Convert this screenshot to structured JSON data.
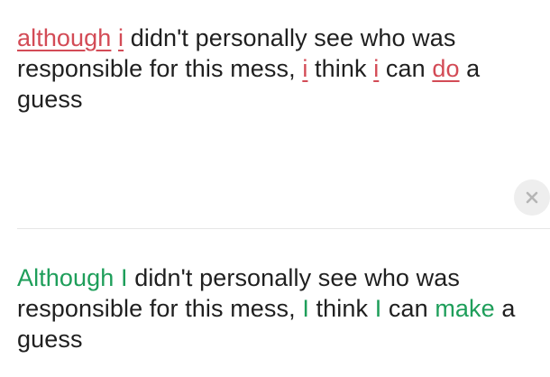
{
  "input": {
    "segments": [
      {
        "text": "although",
        "error": true
      },
      {
        "text": " ",
        "error": false
      },
      {
        "text": "i",
        "error": true
      },
      {
        "text": " didn't personally see who was responsible for this mess, ",
        "error": false
      },
      {
        "text": "i",
        "error": true
      },
      {
        "text": " think ",
        "error": false
      },
      {
        "text": "i",
        "error": true
      },
      {
        "text": " can ",
        "error": false
      },
      {
        "text": "do",
        "error": true
      },
      {
        "text": " a guess",
        "error": false
      }
    ]
  },
  "output": {
    "segments": [
      {
        "text": "Although",
        "fixed": true
      },
      {
        "text": " ",
        "fixed": false
      },
      {
        "text": "I",
        "fixed": true
      },
      {
        "text": " didn't personally see who was responsible for this mess, ",
        "fixed": false
      },
      {
        "text": "I",
        "fixed": true
      },
      {
        "text": " think ",
        "fixed": false
      },
      {
        "text": "I",
        "fixed": true
      },
      {
        "text": " can ",
        "fixed": false
      },
      {
        "text": "make",
        "fixed": true
      },
      {
        "text": " a guess",
        "fixed": false
      }
    ]
  },
  "clear_button": {
    "icon": "close-icon"
  },
  "colors": {
    "error": "#d34b56",
    "correction": "#1e9e5a",
    "text": "#1f1f1f"
  }
}
